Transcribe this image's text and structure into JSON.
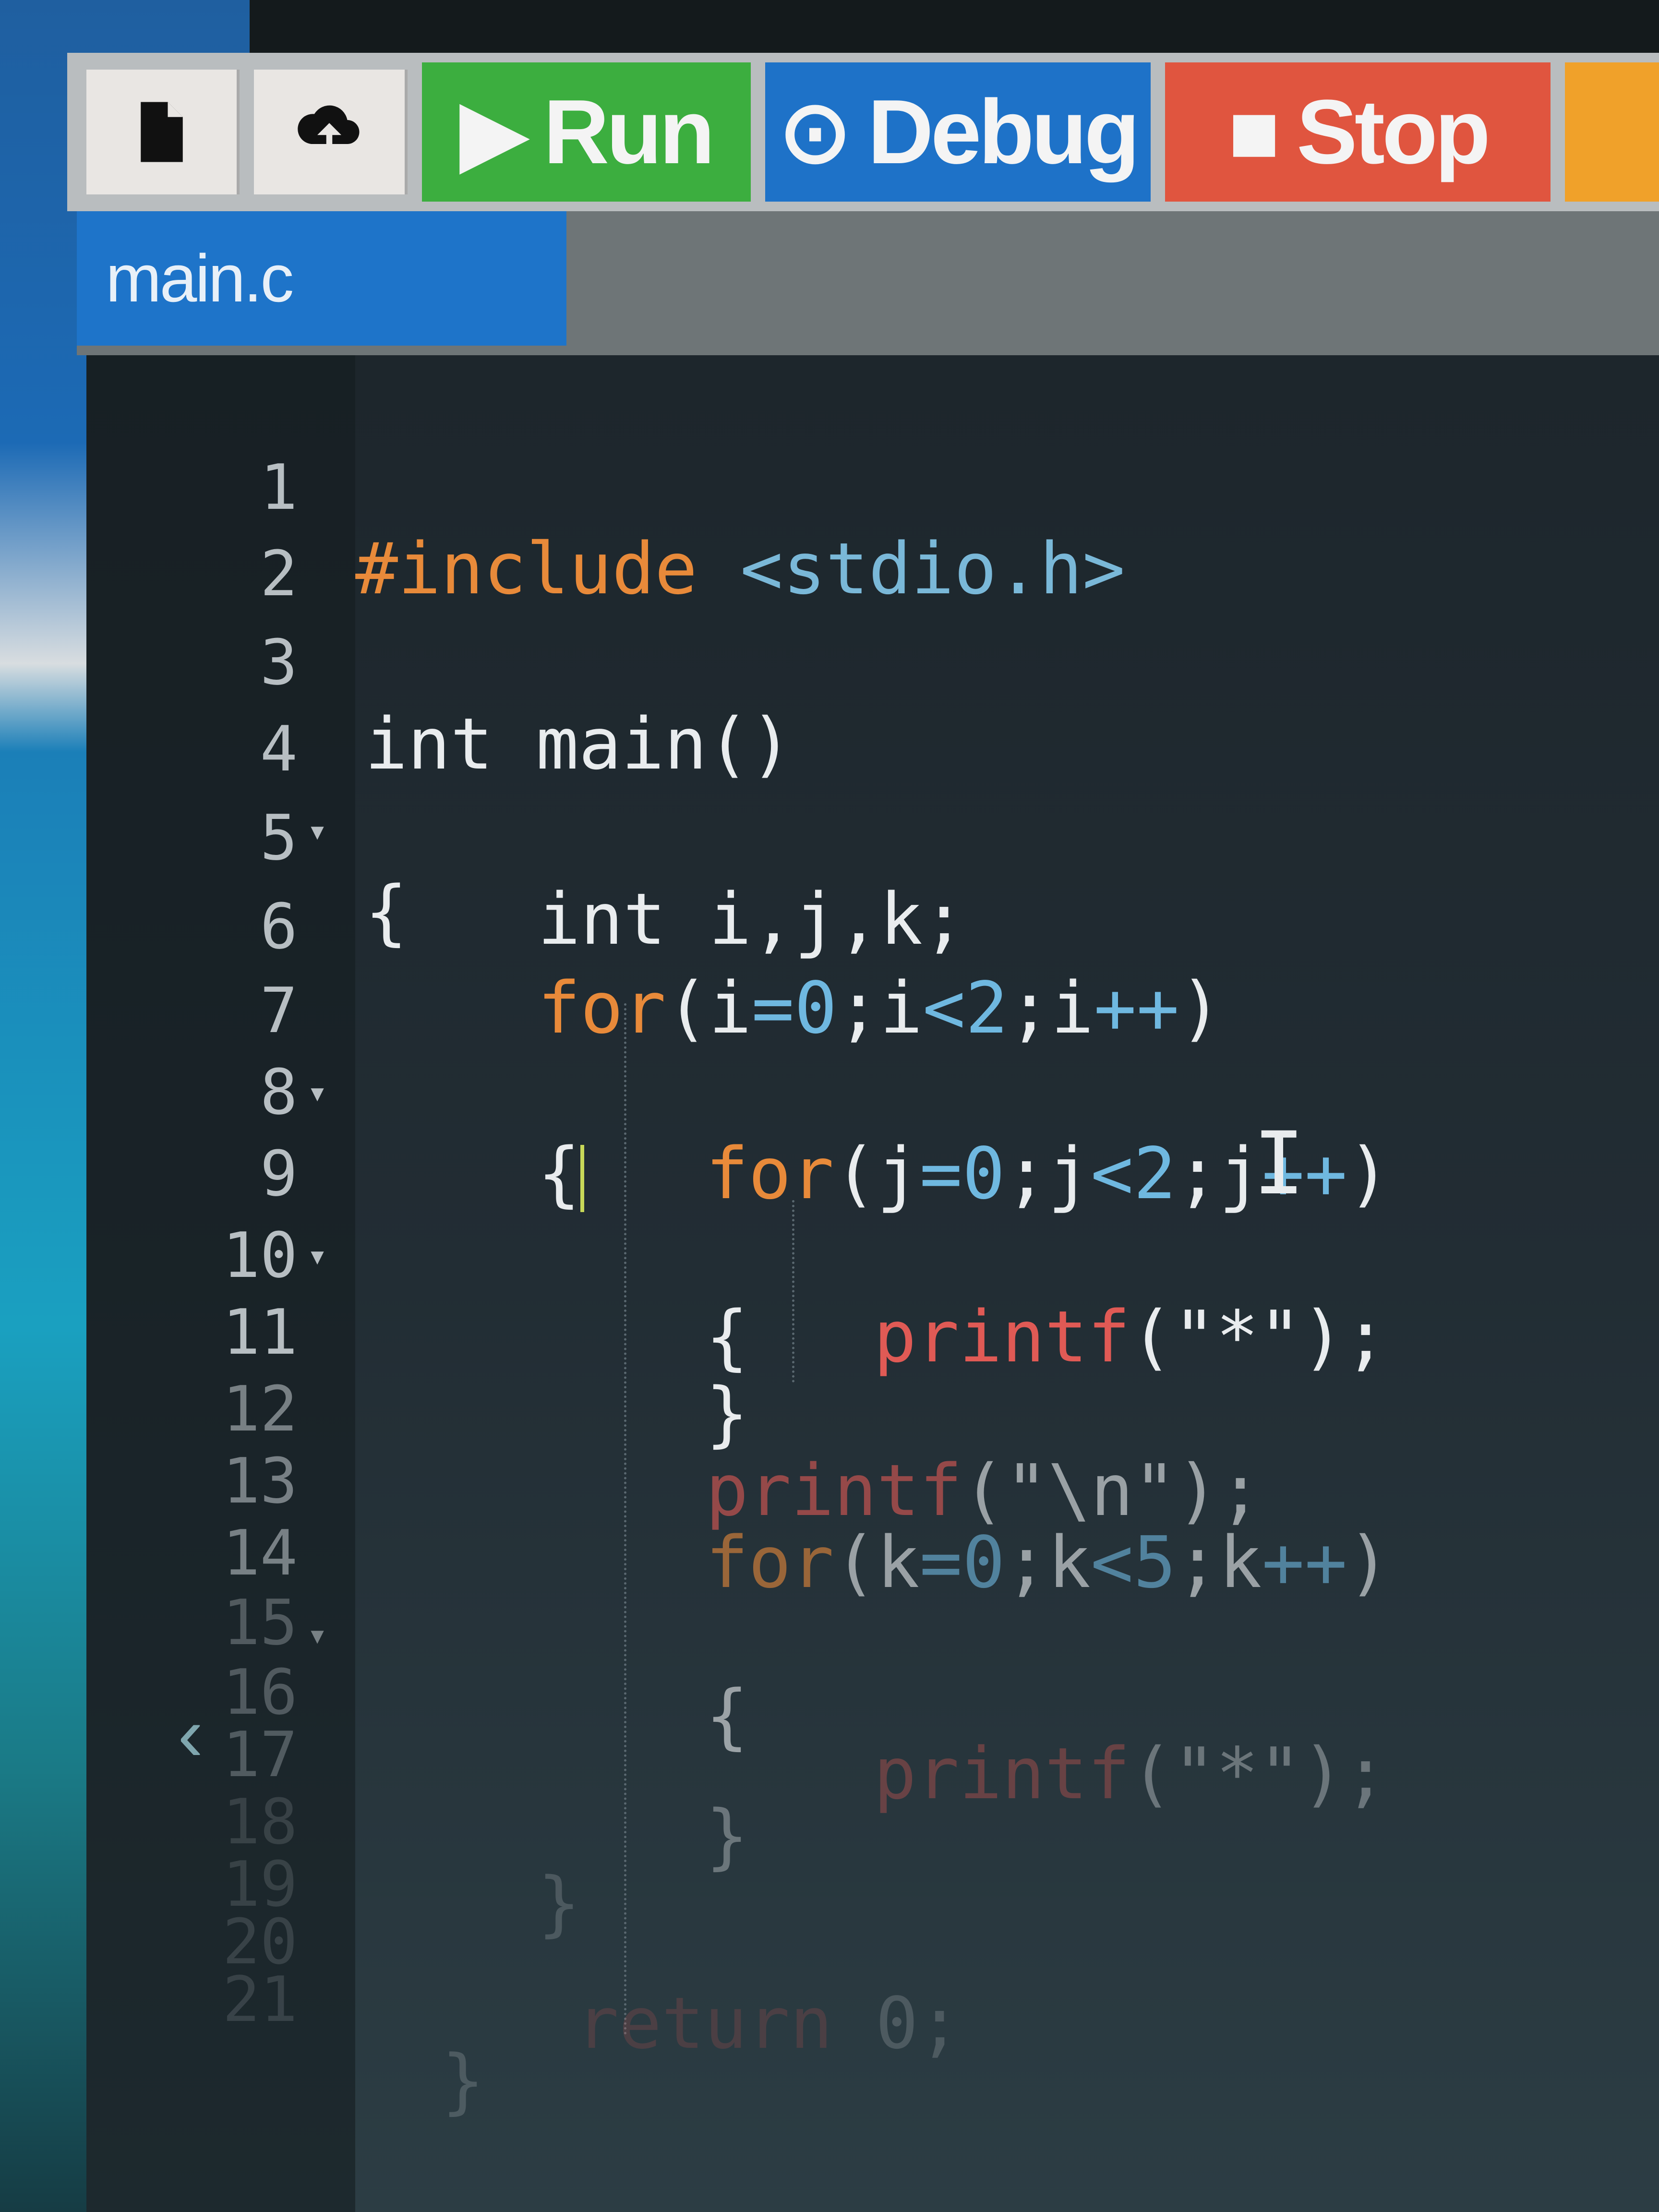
{
  "toolbar": {
    "new_file_icon": "file-icon",
    "upload_icon": "cloud-upload-icon",
    "run_label": "Run",
    "debug_label": "Debug",
    "stop_label": "Stop",
    "colors": {
      "run": "#3cae3f",
      "debug": "#1e72c8",
      "stop": "#e0553f"
    }
  },
  "tabs": [
    {
      "label": "main.c",
      "active": true
    }
  ],
  "editor": {
    "lines": [
      {
        "n": "1",
        "text": "#include <stdio.h>"
      },
      {
        "n": "2",
        "text": ""
      },
      {
        "n": "3",
        "text": "int main()"
      },
      {
        "n": "4",
        "text": "{"
      },
      {
        "n": "5",
        "text": "    int i,j,k;"
      },
      {
        "n": "6",
        "text": "    for(i=0;i<2;i++)"
      },
      {
        "n": "7",
        "text": "    {"
      },
      {
        "n": "8",
        "text": "        for(j=0;j<2;j++)"
      },
      {
        "n": "9",
        "text": "        {"
      },
      {
        "n": "10",
        "text": "            printf(\"*\");"
      },
      {
        "n": "11",
        "text": "        }"
      },
      {
        "n": "12",
        "text": "        printf(\"\\n\");"
      },
      {
        "n": "13",
        "text": "        for(k=0;k<5;k++)"
      },
      {
        "n": "14",
        "text": "        {"
      },
      {
        "n": "15",
        "text": ""
      },
      {
        "n": "16",
        "text": "            printf(\"*\");"
      },
      {
        "n": "17",
        "text": "        }"
      },
      {
        "n": "18",
        "text": "    }"
      },
      {
        "n": "19",
        "text": ""
      },
      {
        "n": "20",
        "text": "    return 0;"
      },
      {
        "n": "21",
        "text": "}"
      }
    ]
  }
}
